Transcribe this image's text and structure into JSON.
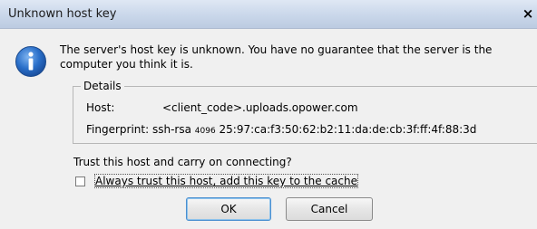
{
  "window": {
    "title": "Unknown host key",
    "close_glyph": "×"
  },
  "icon": {
    "name": "info-icon",
    "color": "#2a6fc9",
    "glyph": "i"
  },
  "message": {
    "line1": "The server's host key is unknown. You have no guarantee that the server is the",
    "line2": "computer you think it is."
  },
  "details": {
    "legend": "Details",
    "host_label": "Host:",
    "host_value": "<client_code>.uploads.opower.com",
    "fingerprint_label": "Fingerprint:",
    "fingerprint_type": "ssh-rsa",
    "fingerprint_bits": "4096",
    "fingerprint_value": "25:97:ca:f3:50:62:b2:11:da:de:cb:3f:ff:4f:88:3d"
  },
  "prompt": {
    "question": "Trust this host and carry on connecting?",
    "checkbox_label": "Always trust this host, add this key to the cache",
    "checkbox_checked": false
  },
  "buttons": {
    "ok": "OK",
    "cancel": "Cancel"
  },
  "colors": {
    "dialog_bg": "#f0f0f0",
    "titlebar_top": "#dfe8f4",
    "titlebar_bottom": "#bccbe1",
    "default_button_border": "#4a8fd0"
  }
}
